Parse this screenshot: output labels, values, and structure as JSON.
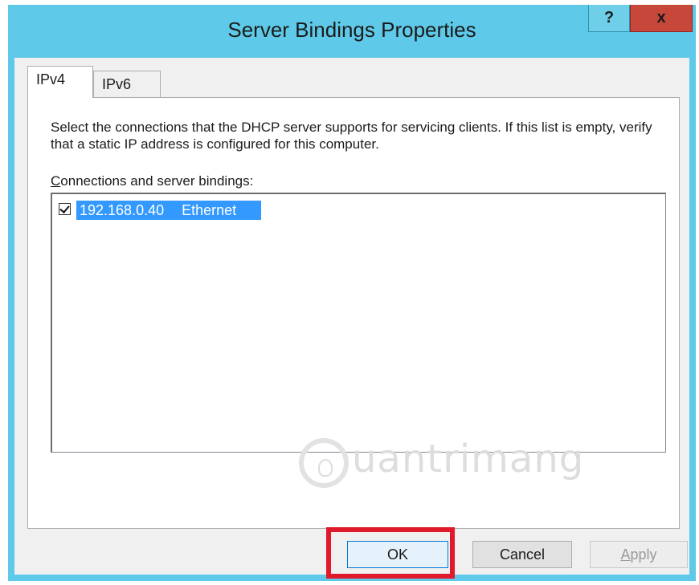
{
  "window": {
    "title": "Server Bindings Properties",
    "help_label": "?",
    "close_label": "x"
  },
  "tabs": [
    {
      "label": "IPv4",
      "active": true
    },
    {
      "label": "IPv6",
      "active": false
    }
  ],
  "content": {
    "description": "Select the connections that the DHCP server supports for servicing clients. If this list is empty, verify that a static IP address is configured for this computer.",
    "list_label_mnemonic": "C",
    "list_label_rest": "onnections and server bindings:",
    "bindings": [
      {
        "checked": true,
        "ip": "192.168.0.40",
        "interface": "Ethernet",
        "selected": true
      }
    ]
  },
  "buttons": {
    "ok": "OK",
    "cancel": "Cancel",
    "apply_mnemonic": "A",
    "apply_rest": "pply"
  },
  "watermark": "uantrimang",
  "colors": {
    "titlebar": "#5ec9e8",
    "close_button": "#c7473b",
    "selection": "#3399ff",
    "highlight_box": "#e01a2c"
  }
}
